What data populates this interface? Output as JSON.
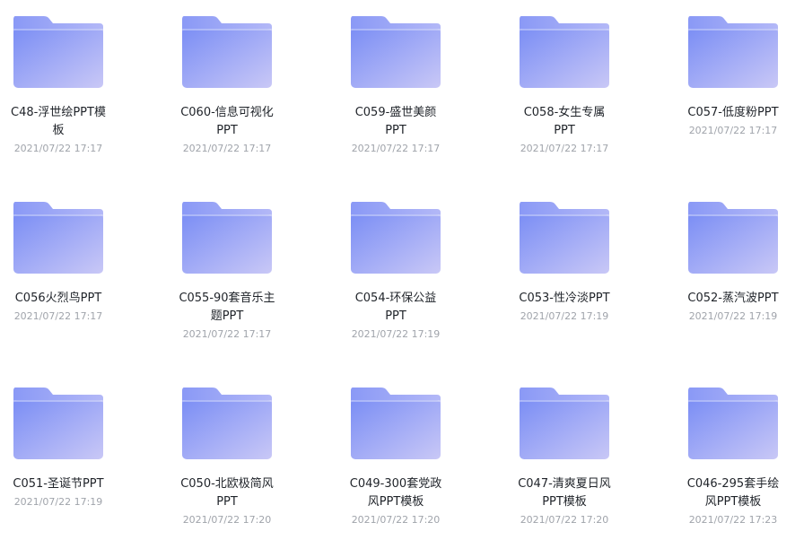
{
  "items": [
    {
      "line1": "C48-浮世绘PPT模",
      "line2": "板",
      "date": "2021/07/22 17:17"
    },
    {
      "line1": "C060-信息可视化",
      "line2": "PPT",
      "date": "2021/07/22 17:17"
    },
    {
      "line1": "C059-盛世美颜",
      "line2": "PPT",
      "date": "2021/07/22 17:17"
    },
    {
      "line1": "C058-女生专属",
      "line2": "PPT",
      "date": "2021/07/22 17:17"
    },
    {
      "line1": "C057-低度粉PPT",
      "line2": "",
      "date": "2021/07/22 17:17"
    },
    {
      "line1": "C056火烈鸟PPT",
      "line2": "",
      "date": "2021/07/22 17:17"
    },
    {
      "line1": "C055-90套音乐主",
      "line2": "题PPT",
      "date": "2021/07/22 17:17"
    },
    {
      "line1": "C054-环保公益",
      "line2": "PPT",
      "date": "2021/07/22 17:19"
    },
    {
      "line1": "C053-性冷淡PPT",
      "line2": "",
      "date": "2021/07/22 17:19"
    },
    {
      "line1": "C052-蒸汽波PPT",
      "line2": "",
      "date": "2021/07/22 17:19"
    },
    {
      "line1": "C051-圣诞节PPT",
      "line2": "",
      "date": "2021/07/22 17:19"
    },
    {
      "line1": "C050-北欧极简风",
      "line2": "PPT",
      "date": "2021/07/22 17:20"
    },
    {
      "line1": "C049-300套党政",
      "line2": "风PPT模板",
      "date": "2021/07/22 17:20"
    },
    {
      "line1": "C047-清爽夏日风",
      "line2": "PPT模板",
      "date": "2021/07/22 17:20"
    },
    {
      "line1": "C046-295套手绘",
      "line2": "风PPT模板",
      "date": "2021/07/22 17:23"
    }
  ],
  "colors": {
    "folder_back": "#8d9cf7",
    "folder_front_start": "#7b8ef5",
    "folder_front_end": "#c9c8f6",
    "name_text": "#1f2329",
    "date_text": "#a0a4ab"
  },
  "icon": "folder-icon"
}
